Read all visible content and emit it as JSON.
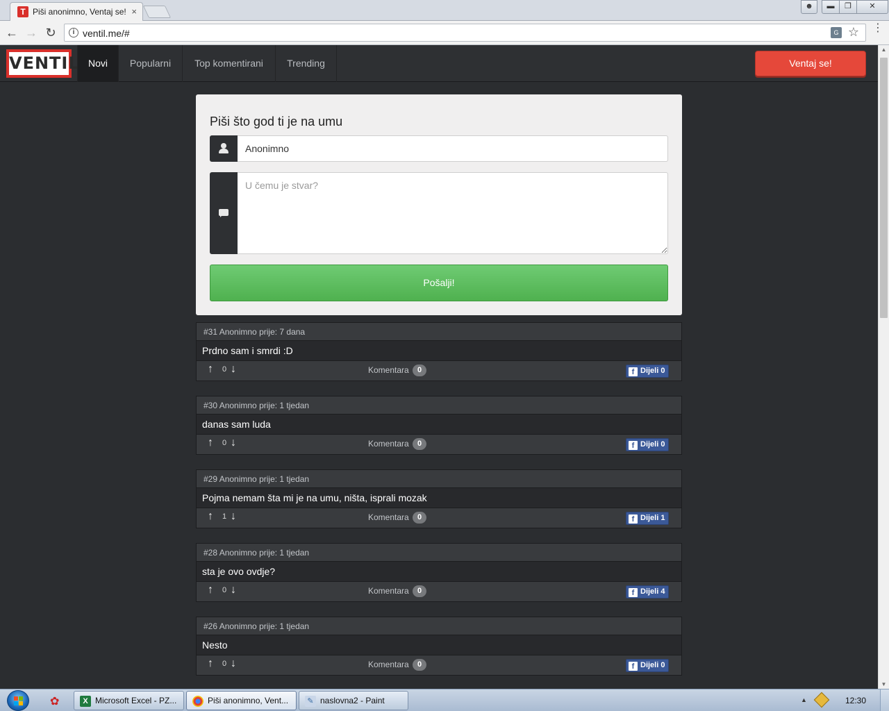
{
  "browser": {
    "tab_title": "Piši anonimno, Ventaj se!",
    "tab_favicon": "T",
    "url": "ventil.me/#",
    "colors": {
      "favicon": "#d9302b"
    }
  },
  "site": {
    "logo_text": "VENTIL",
    "nav": [
      {
        "label": "Novi",
        "active": true
      },
      {
        "label": "Popularni",
        "active": false
      },
      {
        "label": "Top komentirani",
        "active": false
      },
      {
        "label": "Trending",
        "active": false
      }
    ],
    "vent_button": "Ventaj se!",
    "colors": {
      "nav_bg": "#2e3033",
      "accent_red": "#e5483a",
      "submit_green": "#5cb85c",
      "facebook_blue": "#3b5998"
    }
  },
  "form": {
    "title": "Piši što god ti je na umu",
    "name_value": "Anonimno",
    "message_placeholder": "U čemu je stvar?",
    "submit_label": "Pošalji!",
    "icons": {
      "name": "user-icon",
      "message": "chat-bubble-icon"
    }
  },
  "posts": [
    {
      "meta": "#31 Anonimno prije: 7 dana",
      "text": "Prdno sam i smrdi :D",
      "votes": "0",
      "comments_label": "Komentara",
      "comments": "0",
      "share_label": "Dijeli 0"
    },
    {
      "meta": "#30 Anonimno prije: 1 tjedan",
      "text": "danas sam luda",
      "votes": "0",
      "comments_label": "Komentara",
      "comments": "0",
      "share_label": "Dijeli 0"
    },
    {
      "meta": "#29 Anonimno prije: 1 tjedan",
      "text": "Pojma nemam šta mi je na umu, ništa, isprali mozak",
      "votes": "1",
      "comments_label": "Komentara",
      "comments": "0",
      "share_label": "Dijeli 1"
    },
    {
      "meta": "#28 Anonimno prije: 1 tjedan",
      "text": "sta je ovo ovdje?",
      "votes": "0",
      "comments_label": "Komentara",
      "comments": "0",
      "share_label": "Dijeli 4"
    },
    {
      "meta": "#26 Anonimno prije: 1 tjedan",
      "text": "Nesto",
      "votes": "0",
      "comments_label": "Komentara",
      "comments": "0",
      "share_label": "Dijeli 0"
    }
  ],
  "taskbar": {
    "tasks": [
      {
        "label": "Microsoft Excel - PZ...",
        "icon": "excel-icon",
        "active": false
      },
      {
        "label": "Piši anonimno, Vent...",
        "icon": "chrome-icon",
        "active": true
      },
      {
        "label": "naslovna2 - Paint",
        "icon": "paint-icon",
        "active": false
      }
    ],
    "clock": "12:30"
  }
}
